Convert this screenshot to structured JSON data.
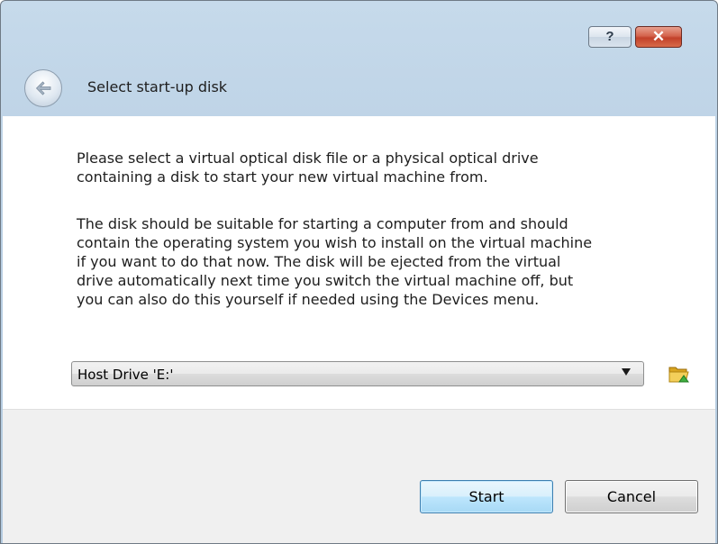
{
  "titlebar": {
    "help_label": "?",
    "close_label": "✕"
  },
  "header": {
    "title": "Select start-up disk"
  },
  "content": {
    "paragraph1": "Please select a virtual optical disk file or a physical optical drive\ncontaining a disk to start your new virtual machine from.",
    "paragraph2": "The disk should be suitable for starting a computer from and should\ncontain the operating system you wish to install on the virtual machine\nif you want to do that now. The disk will be ejected from the virtual\ndrive automatically next time you switch the virtual machine off, but\nyou can also do this yourself if needed using the Devices menu.",
    "disk_select": {
      "selected": "Host Drive 'E:'"
    }
  },
  "footer": {
    "start_label": "Start",
    "cancel_label": "Cancel"
  },
  "icons": {
    "back": "back-arrow-icon",
    "folder": "folder-open-icon",
    "dropdown": "chevron-down-icon"
  },
  "colors": {
    "titlebar": "#b9cfe3",
    "close_button": "#c2412a",
    "default_button_border": "#3c7fb1",
    "footer": "#f0f0f0"
  }
}
